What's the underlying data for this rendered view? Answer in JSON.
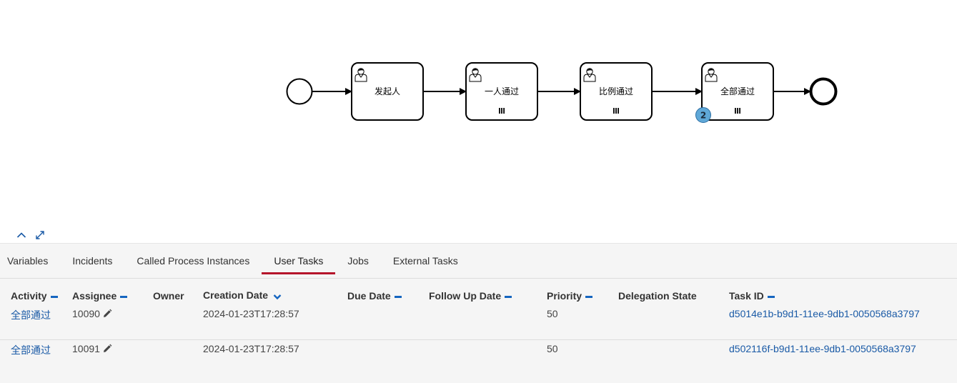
{
  "diagram": {
    "tasks": [
      {
        "label": "发起人",
        "multi_instance": false,
        "badge": ""
      },
      {
        "label": "一人通过",
        "multi_instance": true,
        "badge": ""
      },
      {
        "label": "比例通过",
        "multi_instance": true,
        "badge": ""
      },
      {
        "label": "全部通过",
        "multi_instance": true,
        "badge": "2"
      }
    ],
    "badge_color": "#5fa8d8"
  },
  "controls": {
    "collapse_icon": "chevron-up-icon",
    "fullscreen_icon": "expand-icon"
  },
  "tabs": [
    {
      "label": "Variables",
      "active": false
    },
    {
      "label": "Incidents",
      "active": false
    },
    {
      "label": "Called Process Instances",
      "active": false
    },
    {
      "label": "User Tasks",
      "active": true
    },
    {
      "label": "Jobs",
      "active": false
    },
    {
      "label": "External Tasks",
      "active": false
    }
  ],
  "table": {
    "headers": {
      "activity": "Activity",
      "assignee": "Assignee",
      "owner": "Owner",
      "creation_date": "Creation Date",
      "due_date": "Due Date",
      "follow_up_date": "Follow Up Date",
      "priority": "Priority",
      "delegation_state": "Delegation State",
      "task_id": "Task ID"
    },
    "rows": [
      {
        "activity": "全部通过",
        "assignee": "10090",
        "owner": "",
        "creation_date": "2024-01-23T17:28:57",
        "due_date": "",
        "follow_up_date": "",
        "priority": "50",
        "delegation_state": "",
        "task_id": "d5014e1b-b9d1-11ee-9db1-0050568a3797"
      },
      {
        "activity": "全部通过",
        "assignee": "10091",
        "owner": "",
        "creation_date": "2024-01-23T17:28:57",
        "due_date": "",
        "follow_up_date": "",
        "priority": "50",
        "delegation_state": "",
        "task_id": "d502116f-b9d1-11ee-9db1-0050568a3797"
      }
    ]
  },
  "colors": {
    "accent_tab": "#b5152b",
    "link": "#1a5aa6",
    "sort_icon": "#1565c0"
  }
}
